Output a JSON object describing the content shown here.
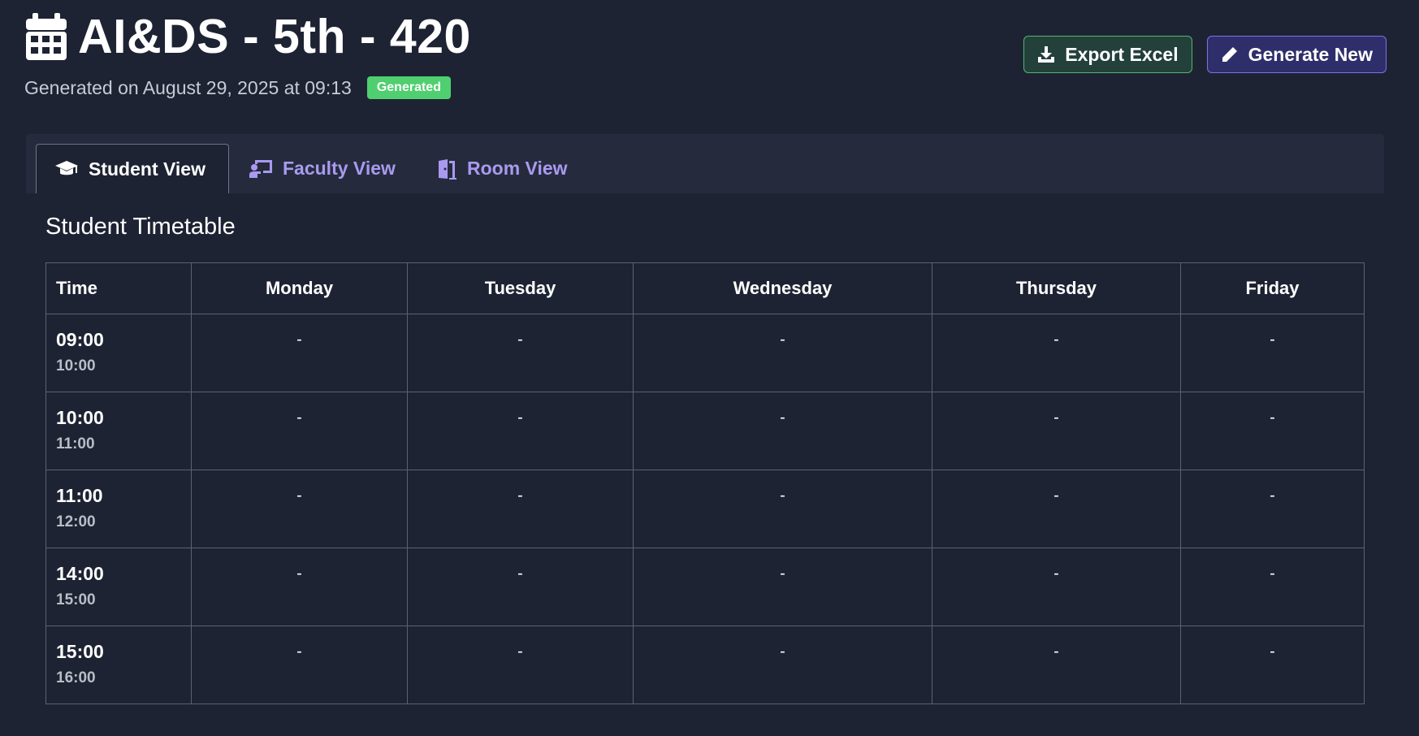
{
  "header": {
    "title": "AI&DS - 5th - 420",
    "title_icon": "calendar-icon",
    "generated_on": "Generated on August 29, 2025 at 09:13",
    "status_badge": "Generated",
    "status_color": "#4fcf6f"
  },
  "actions": {
    "export_label": "Export Excel",
    "export_icon": "download-icon",
    "generate_label": "Generate New",
    "generate_icon": "pencil-icon"
  },
  "tabs": [
    {
      "label": "Student View",
      "icon": "graduation-cap-icon",
      "active": true
    },
    {
      "label": "Faculty View",
      "icon": "chalkboard-teacher-icon",
      "active": false
    },
    {
      "label": "Room View",
      "icon": "door-open-icon",
      "active": false
    }
  ],
  "timetable": {
    "title": "Student Timetable",
    "columns": [
      "Time",
      "Monday",
      "Tuesday",
      "Wednesday",
      "Thursday",
      "Friday"
    ],
    "rows": [
      {
        "start": "09:00",
        "end": "10:00",
        "cells": [
          "-",
          "-",
          "-",
          "-",
          "-"
        ]
      },
      {
        "start": "10:00",
        "end": "11:00",
        "cells": [
          "-",
          "-",
          "-",
          "-",
          "-"
        ]
      },
      {
        "start": "11:00",
        "end": "12:00",
        "cells": [
          "-",
          "-",
          "-",
          "-",
          "-"
        ]
      },
      {
        "start": "14:00",
        "end": "15:00",
        "cells": [
          "-",
          "-",
          "-",
          "-",
          "-"
        ]
      },
      {
        "start": "15:00",
        "end": "16:00",
        "cells": [
          "-",
          "-",
          "-",
          "-",
          "-"
        ]
      }
    ]
  },
  "colors": {
    "background": "#1e2333",
    "tabbar": "#252b3c",
    "accent_purple": "#a99af0",
    "export_border": "#4fb86d",
    "generate_border": "#7a72e8"
  }
}
